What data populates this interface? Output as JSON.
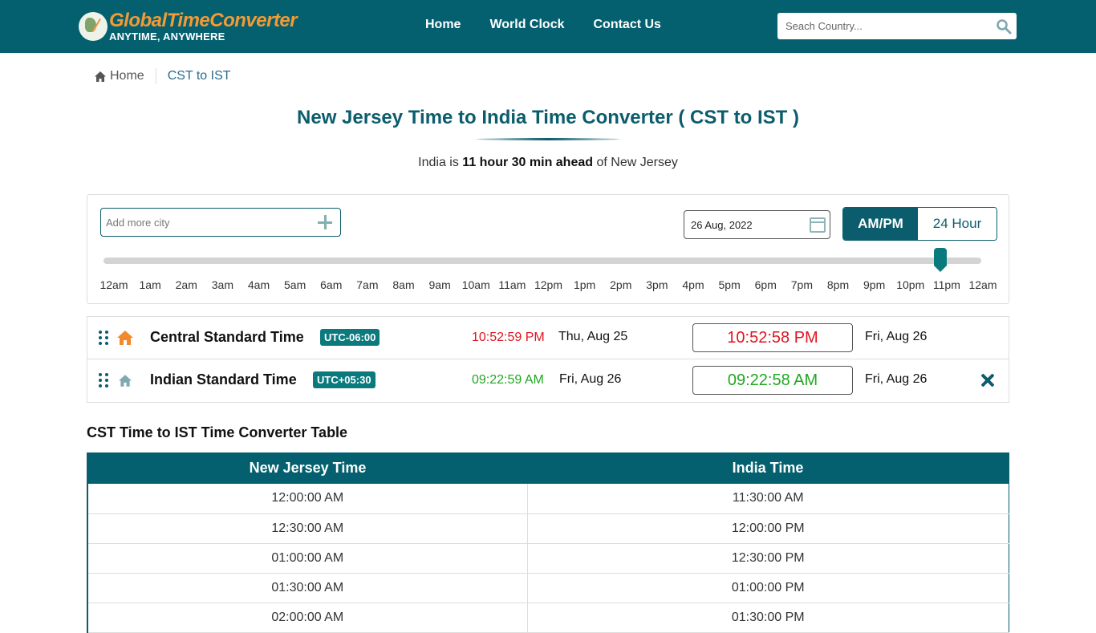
{
  "header": {
    "logo_title": "GlobalTimeConverter",
    "logo_tagline": "ANYTIME, ANYWHERE",
    "nav": [
      {
        "label": "Home"
      },
      {
        "label": "World Clock"
      },
      {
        "label": "Contact Us"
      }
    ],
    "search_placeholder": "Seach Country..."
  },
  "breadcrumb": {
    "home": "Home",
    "current": "CST to IST"
  },
  "page": {
    "title": "New Jersey Time to India Time Converter ( CST to IST )",
    "subtitle_prefix": "India is ",
    "subtitle_bold": "11 hour 30 min ahead",
    "subtitle_suffix": " of New Jersey"
  },
  "controls": {
    "add_city_placeholder": "Add more city",
    "date_value": "26 Aug, 2022",
    "format_options": [
      "AM/PM",
      "24 Hour"
    ],
    "format_selected": "AM/PM",
    "slider_hour_value": 22.88,
    "slider_max_hours": 24,
    "hour_labels": [
      "12am",
      "1am",
      "2am",
      "3am",
      "4am",
      "5am",
      "6am",
      "7am",
      "8am",
      "9am",
      "10am",
      "11am",
      "12pm",
      "1pm",
      "2pm",
      "3pm",
      "4pm",
      "5pm",
      "6pm",
      "7pm",
      "8pm",
      "9pm",
      "10pm",
      "11pm",
      "12am"
    ]
  },
  "timezones": [
    {
      "name": "Central Standard Time",
      "utc": "UTC-06:00",
      "live_time": "10:52:59 PM",
      "live_date": "Thu, Aug 25",
      "converted_time": "10:52:58 PM",
      "converted_date": "Fri, Aug 26",
      "time_color": "#e0141e",
      "home_color": "#f28a2c",
      "removable": false
    },
    {
      "name": "Indian Standard Time",
      "utc": "UTC+05:30",
      "live_time": "09:22:59 AM",
      "live_date": "Fri, Aug 26",
      "converted_time": "09:22:58 AM",
      "converted_date": "Fri, Aug 26",
      "time_color": "#22a722",
      "home_color": "#7fa8b0",
      "removable": true
    }
  ],
  "table": {
    "title": "CST Time to IST Time Converter Table",
    "headers": [
      "New Jersey Time",
      "India Time"
    ],
    "rows": [
      [
        "12:00:00 AM",
        "11:30:00 AM"
      ],
      [
        "12:30:00 AM",
        "12:00:00 PM"
      ],
      [
        "01:00:00 AM",
        "12:30:00 PM"
      ],
      [
        "01:30:00 AM",
        "01:00:00 PM"
      ],
      [
        "02:00:00 AM",
        "01:30:00 PM"
      ]
    ]
  },
  "colors": {
    "brand": "#04606f",
    "accent": "#f39a35",
    "slider": "#0b7a7d"
  }
}
